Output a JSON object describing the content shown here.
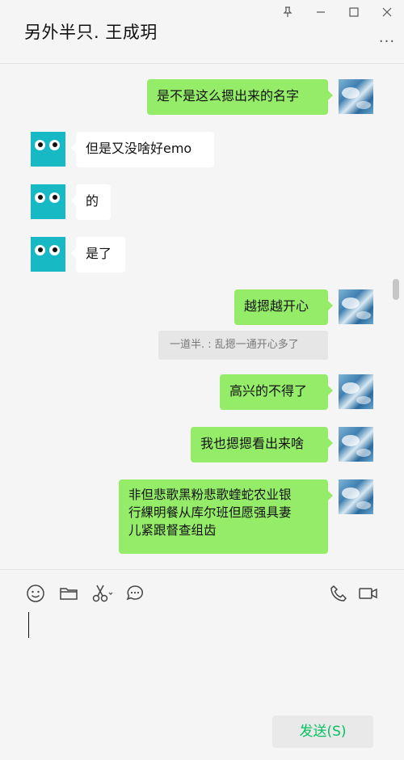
{
  "window": {
    "title": "另外半只. 王成玥",
    "more_label": "..."
  },
  "messages": [
    {
      "sender": "me",
      "text": "是不是这么摁出来的名字"
    },
    {
      "sender": "other",
      "text": "但是又没啥好emo"
    },
    {
      "sender": "other",
      "text": "的"
    },
    {
      "sender": "other",
      "text": "是了"
    },
    {
      "sender": "me",
      "text": "越摁越开心"
    },
    {
      "sender": "quote",
      "text": "一道半. : 乱摁一通开心多了"
    },
    {
      "sender": "me",
      "text": "高兴的不得了"
    },
    {
      "sender": "me",
      "text": "我也摁摁看出来啥"
    },
    {
      "sender": "me",
      "lines": [
        "非但悲歌黑粉悲歌蝰蛇农业银",
        "行綶明餐从库尔班但愿强具妻",
        "儿紧跟督查组齿"
      ]
    }
  ],
  "toolbar": {
    "icons": [
      "emoji-icon",
      "folder-icon",
      "scissors-icon",
      "chat-history-icon",
      "phone-icon",
      "video-icon"
    ]
  },
  "input": {
    "value": "",
    "send_label": "发送(S)"
  },
  "colors": {
    "my_bubble": "#95ec69",
    "other_bubble": "#ffffff",
    "send_text": "#07c160",
    "avatar_other": "#16b9c4"
  }
}
